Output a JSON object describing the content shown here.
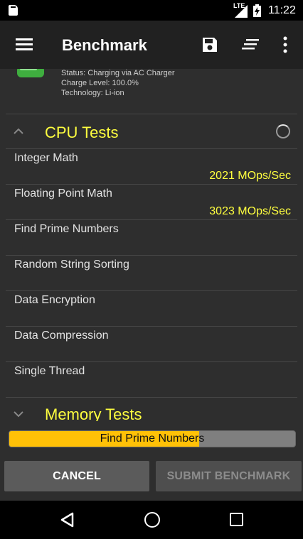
{
  "status_bar": {
    "network": "LTE",
    "time": "11:22"
  },
  "app_bar": {
    "title": "Benchmark",
    "icons": [
      "menu-icon",
      "save-icon",
      "sort-icon",
      "overflow-icon"
    ]
  },
  "battery_info": {
    "status": "Status: Charging via AC Charger",
    "charge_level": "Charge Level: 100.0%",
    "technology": "Technology: Li-ion"
  },
  "cpu_section": {
    "title": "CPU Tests",
    "expanded": true,
    "tests": [
      {
        "name": "Integer Math",
        "result": "2021 MOps/Sec"
      },
      {
        "name": "Floating Point Math",
        "result": "3023 MOps/Sec"
      },
      {
        "name": "Find Prime Numbers",
        "result": ""
      },
      {
        "name": "Random String Sorting",
        "result": ""
      },
      {
        "name": "Data Encryption",
        "result": ""
      },
      {
        "name": "Data Compression",
        "result": ""
      },
      {
        "name": "Single Thread",
        "result": ""
      }
    ]
  },
  "memory_section": {
    "title": "Memory Tests",
    "expanded": false
  },
  "progress": {
    "label": "Find Prime Numbers",
    "fraction": 0.665
  },
  "buttons": {
    "cancel": "CANCEL",
    "submit": "SUBMIT BENCHMARK"
  },
  "colors": {
    "accent": "#ffff3f",
    "progress": "#ffc107",
    "background": "#2e2e2e",
    "app_bar": "#212121"
  }
}
